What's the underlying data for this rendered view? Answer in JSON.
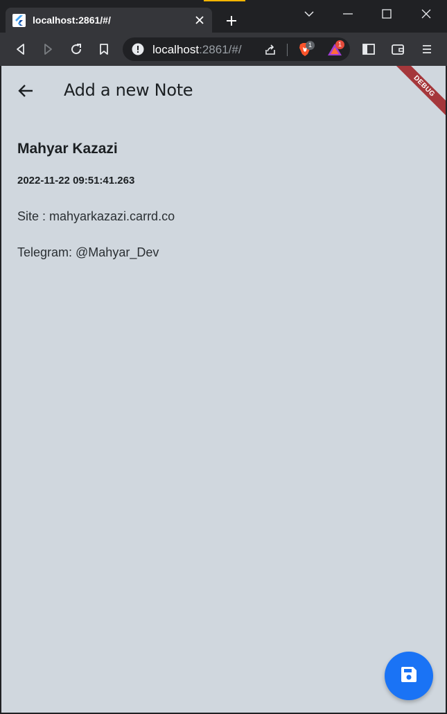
{
  "browser": {
    "tab": {
      "title": "localhost:2861/#/",
      "favicon": "flutter-icon"
    },
    "address": {
      "host": "localhost",
      "rest": ":2861/#/"
    },
    "shield_badge": "1",
    "rewards_badge": "1",
    "colors": {
      "chrome_bg": "#202124",
      "toolbar_bg": "#35363a",
      "shield": "#fb542b"
    }
  },
  "app": {
    "title": "Add a new Note",
    "debug_banner": "DEBUG",
    "note": {
      "name": "Mahyar Kazazi",
      "date": "2022-11-22 09:51:41.263",
      "site": "Site : mahyarkazazi.carrd.co",
      "telegram": "Telegram: @Mahyar_Dev"
    },
    "fab_icon": "save-icon",
    "colors": {
      "background": "#d0d7de",
      "fab": "#1a73f5",
      "debug": "#a5373b"
    }
  }
}
